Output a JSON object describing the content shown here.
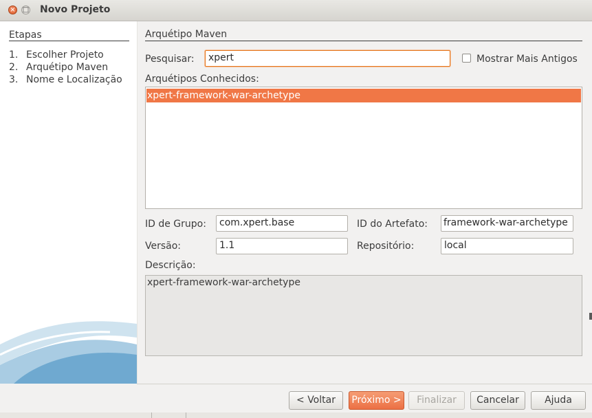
{
  "window": {
    "title": "Novo Projeto",
    "close_glyph": "×",
    "maximize_glyph": "□"
  },
  "steps": {
    "title": "Etapas",
    "items": [
      {
        "num": "1.",
        "label": "Escolher Projeto"
      },
      {
        "num": "2.",
        "label": "Arquétipo Maven"
      },
      {
        "num": "3.",
        "label": "Nome e Localização"
      }
    ]
  },
  "panel": {
    "title": "Arquétipo Maven",
    "search_label": "Pesquisar:",
    "search_value": "xpert",
    "show_older_label": "Mostrar Mais Antigos",
    "known_archetypes_label": "Arquétipos Conhecidos:",
    "archetypes": [
      "xpert-framework-war-archetype"
    ],
    "group_id_label": "ID de Grupo:",
    "group_id_value": "com.xpert.base",
    "artifact_id_label": "ID do Artefato:",
    "artifact_id_value": "framework-war-archetype",
    "version_label": "Versão:",
    "version_value": "1.1",
    "repository_label": "Repositório:",
    "repository_value": "local",
    "description_label": "Descrição:",
    "description_value": "xpert-framework-war-archetype"
  },
  "buttons": {
    "back": "< Voltar",
    "next": "Próximo >",
    "finish": "Finalizar",
    "cancel": "Cancelar",
    "help": "Ajuda"
  },
  "colors": {
    "accent": "#f07746",
    "background": "#f2f1f0"
  }
}
